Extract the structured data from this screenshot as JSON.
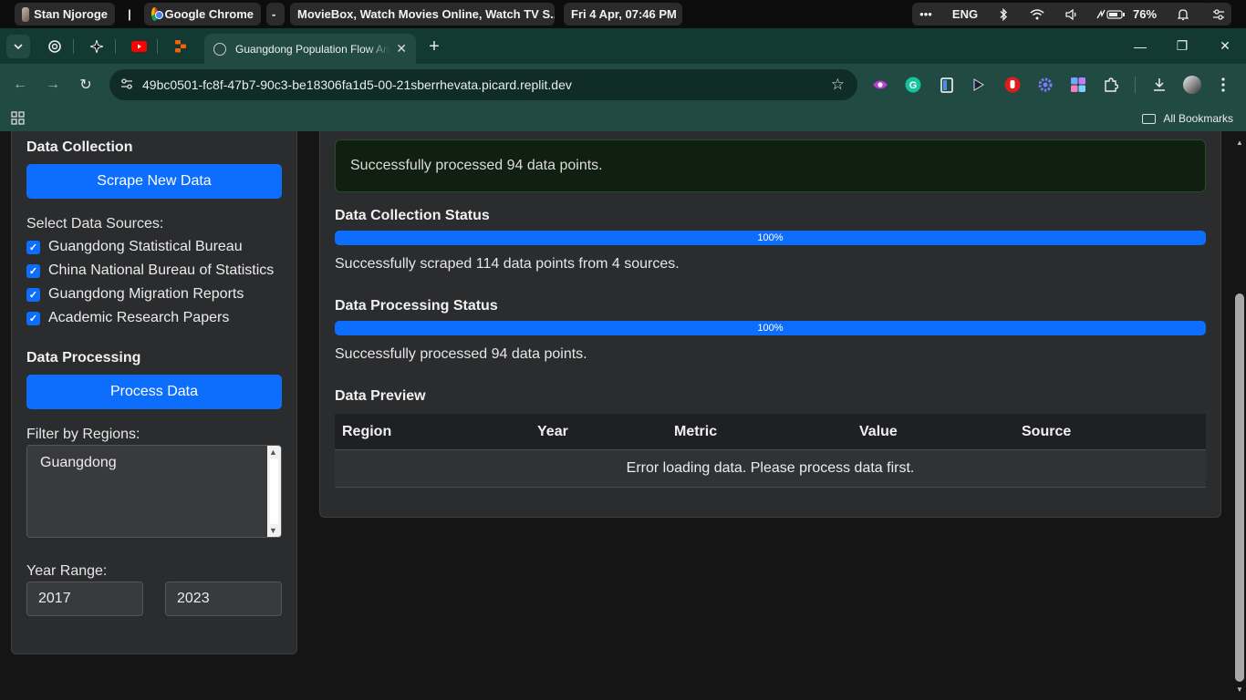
{
  "os": {
    "user": "Stan Njoroge",
    "divider": "|",
    "app": "Google Chrome",
    "dash": "-",
    "window_title": "MovieBox, Watch Movies Online, Watch TV S...",
    "datetime": "Fri 4 Apr, 07:46 PM",
    "more": "•••",
    "lang": "ENG",
    "battery": "76%"
  },
  "browser": {
    "tab_title": "Guangdong Population Flow Analysis",
    "url": "49bc0501-fc8f-47b7-90c3-be18306fa1d5-00-21sberrhevata.picard.replit.dev",
    "all_bookmarks": "All Bookmarks",
    "new_tab": "+",
    "minimize": "—",
    "maximize": "❐",
    "close": "✕"
  },
  "sidebar": {
    "collection_title": "Data Collection",
    "scrape_button": "Scrape New Data",
    "sources_label": "Select Data Sources:",
    "sources": [
      "Guangdong Statistical Bureau",
      "China National Bureau of Statistics",
      "Guangdong Migration Reports",
      "Academic Research Papers"
    ],
    "processing_title": "Data Processing",
    "process_button": "Process Data",
    "regions_label": "Filter by Regions:",
    "regions": [
      "Guangdong"
    ],
    "year_label": "Year Range:",
    "year_from": "2017",
    "year_to": "2023"
  },
  "main": {
    "alert": "Successfully processed 94 data points.",
    "collection_status_title": "Data Collection Status",
    "collection_progress": "100%",
    "collection_progress_value": 1.0,
    "collection_message": "Successfully scraped 114 data points from 4 sources.",
    "processing_status_title": "Data Processing Status",
    "processing_progress": "100%",
    "processing_progress_value": 1.0,
    "processing_message": "Successfully processed 94 data points.",
    "preview_title": "Data Preview",
    "table_headers": [
      "Region",
      "Year",
      "Metric",
      "Value",
      "Source"
    ],
    "table_message": "Error loading data. Please process data first."
  },
  "colors": {
    "accent": "#0d6efd",
    "tab_strip": "#123a33",
    "toolbar": "#214a42"
  }
}
